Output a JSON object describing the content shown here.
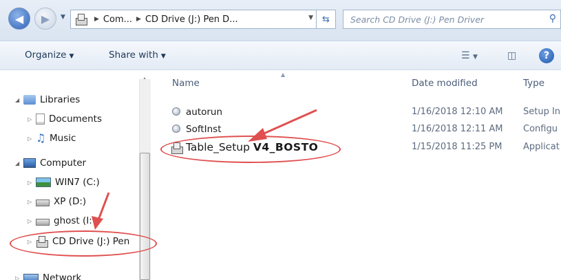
{
  "address": {
    "crumbs": [
      "Com...",
      "CD Drive (J:) Pen D..."
    ],
    "search_placeholder": "Search CD Drive (J:) Pen Driver"
  },
  "toolbar": {
    "organize": "Organize",
    "share_with": "Share with"
  },
  "nav": {
    "libraries": "Libraries",
    "documents": "Documents",
    "music": "Music",
    "computer": "Computer",
    "win7": "WIN7 (C:)",
    "xp": "XP (D:)",
    "ghost": "ghost (I:",
    "cd_drive": "CD Drive (J:) Pen",
    "network": "Network"
  },
  "columns": {
    "name": "Name",
    "date_modified": "Date modified",
    "type": "Type"
  },
  "files": [
    {
      "name": "autorun",
      "date": "1/16/2018 12:10 AM",
      "type": "Setup In"
    },
    {
      "name": "SoftInst",
      "date": "1/16/2018 12:11 AM",
      "type": "Configu"
    },
    {
      "name_prefix": "Table_Setup",
      "name_suffix": "V4_BOSTO",
      "date": "1/15/2018 11:25 PM",
      "type": "Applicat"
    }
  ],
  "colors": {
    "annotation": "#e04f4f",
    "text": "#1e395b"
  }
}
